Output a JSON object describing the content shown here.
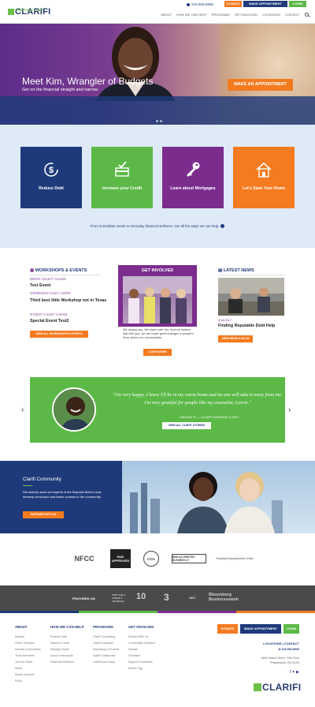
{
  "header": {
    "logo_text": "CLARIFI",
    "logo_tagline": "50 TRIUMPHANT YEARS",
    "phone": "215-563-5665",
    "donate": "DONATE",
    "make_appointment": "MAKE APPOINTMENT",
    "login": "LOGIN",
    "nav": [
      "ABOUT",
      "HOW WE CAN HELP",
      "PROGRAMS",
      "GET INVOLVED",
      "LOCATIONS",
      "CONTACT"
    ]
  },
  "hero": {
    "title": "Meet Kim, Wrangler of Budgets",
    "subtitle": "Get on the financial straight and narrow.",
    "cta": "MAKE AN APPOINTMENT"
  },
  "services": {
    "tiles": [
      {
        "label": "Reduce Debt",
        "color": "#1f3a7a",
        "icon": "dollar-cycle-icon"
      },
      {
        "label": "Increase your Credit",
        "color": "#5cb947",
        "icon": "credit-card-check-icon"
      },
      {
        "label": "Learn about Mortgages",
        "color": "#7b2d8e",
        "icon": "key-icon"
      },
      {
        "label": "Let's Save Your Home",
        "color": "#f47b20",
        "icon": "house-icon"
      }
    ],
    "note": "From immediate needs to everyday financial wellness, see all the ways we can help."
  },
  "workshops": {
    "title": "WORKSHOPS & EVENTS",
    "events": [
      {
        "date": "FRIDAY 3/24/2017 10:42AM",
        "name": "Test Event"
      },
      {
        "date": "WEDNESDAY 5/3/2017 4:00PM",
        "name": "Third best little Workshop not in Texas"
      },
      {
        "date": "SUNDAY 5/14/2017 11:00AM",
        "name": "Special Event Test2"
      }
    ],
    "button": "VIEW ALL WORKSHOPS & EVENTS"
  },
  "get_involved": {
    "title": "GET INVOLVED",
    "text": "We always say, We starts with You. And we believe that with you, we can make great changes in people's lives, and in our communities.",
    "button": "LEARN MORE"
  },
  "news": {
    "title": "LATEST NEWS",
    "date": "3/14/2017",
    "headline": "Finding Reputable Debt Help",
    "button": "VIEW NEWS & BLOG"
  },
  "testimonial": {
    "quote": "\"I'm very happy. I know I'll be in my warm home and no one will take it away from me. I'm very grateful for people like my counselor, Lorrie.\"",
    "attribution": "VINCENT R. — CLARIFI HOUSING CLIENT",
    "button": "VIEW ALL CLIENT STORIES"
  },
  "community": {
    "title": "Clarifi Community",
    "text": "We actively seek out experts in the financial field to host, develop curriculum and teach courses in the community.",
    "button": "PARTNER WITH US"
  },
  "partners": [
    "NFCC",
    "HUD APPROVED",
    "COA",
    "BBB ACCREDITED BUSINESS A+",
    "Financial Empowerment Center"
  ],
  "featured": {
    "label": "FEATURED ON",
    "media": [
      "THE WALL STREET JOURNAL",
      "10",
      "3",
      "NBC",
      "Bloomberg Businessweek"
    ]
  },
  "footer": {
    "columns": [
      {
        "title": "ABOUT",
        "links": [
          "Mission",
          "Client Triumphs",
          "Awards & Accolades",
          "Team Members",
          "Join the Team",
          "News",
          "Media Inquiries",
          "FAQs"
        ]
      },
      {
        "title": "HOW WE CAN HELP",
        "links": [
          "Reduce Debt",
          "Improve Credit",
          "Manage Home",
          "Avoid Foreclosure",
          "Financial Wellness"
        ]
      },
      {
        "title": "PROGRAMS",
        "links": [
          "Clarifi Counseling",
          "Clarifi Education",
          "Workshops & Events",
          "Clarifi Collaborate",
          "Clarifi Boot Camp"
        ]
      },
      {
        "title": "GET INVOLVED",
        "links": [
          "Partner With Us",
          "Community Outreach",
          "Donate",
          "Volunteer",
          "Support Fundraiser",
          "Easter Egg"
        ]
      }
    ],
    "donate": "DONATE",
    "make_appointment": "MAKE APPOINTMENT",
    "login": "LOGIN",
    "locations_contact": "LOCATIONS | CONTACT",
    "phone": "215-563-5665",
    "address_1": "1608 Walnut Street, 10th Floor",
    "address_2": "Philadelphia, PA 19103",
    "logo_text": "CLARIFI"
  },
  "colors": {
    "navy": "#1f3a7a",
    "green": "#5cb947",
    "purple": "#7b2d8e",
    "orange": "#f47b20"
  }
}
